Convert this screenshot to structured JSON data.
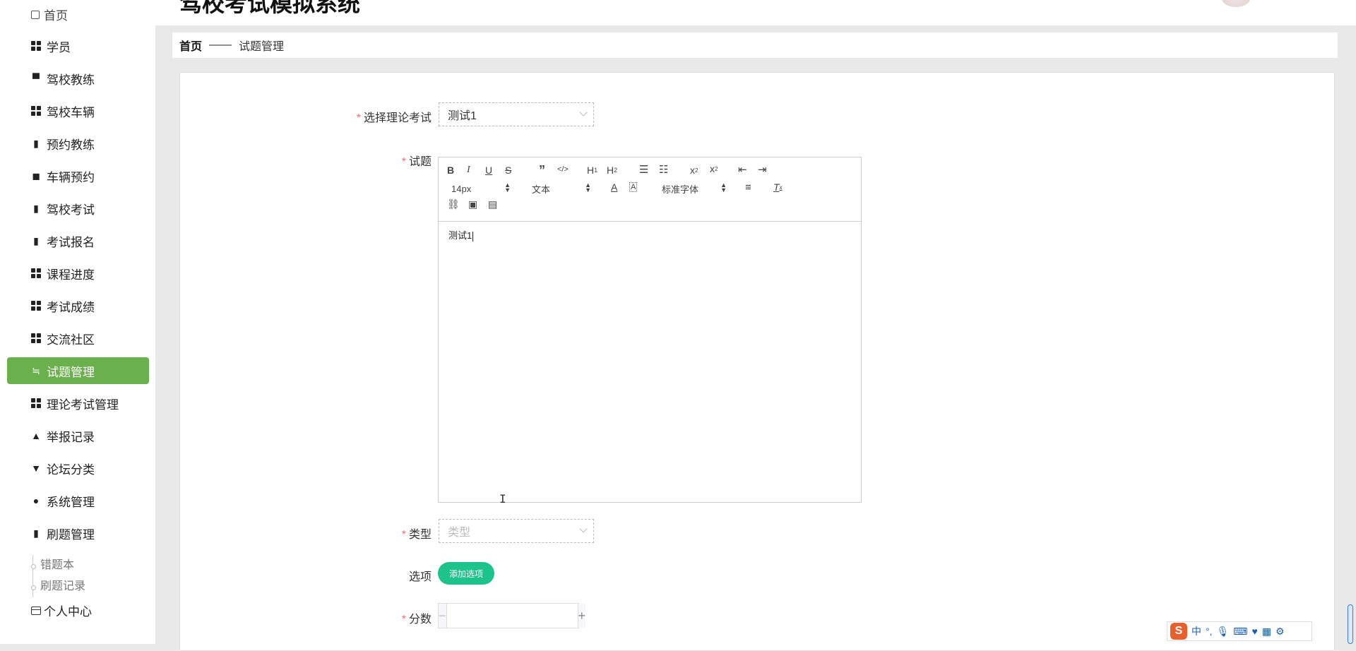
{
  "app": {
    "title": "驾校考试模拟系统"
  },
  "sidebar": {
    "top_item": "首页",
    "items": [
      {
        "label": "学员",
        "icon": "grid-icon"
      },
      {
        "label": "驾校教练",
        "icon": "monitor-icon"
      },
      {
        "label": "驾校车辆",
        "icon": "grid-icon"
      },
      {
        "label": "预约教练",
        "icon": "clipboard-icon"
      },
      {
        "label": "车辆预约",
        "icon": "wallet-icon"
      },
      {
        "label": "驾校考试",
        "icon": "clipboard-x-icon"
      },
      {
        "label": "考试报名",
        "icon": "books-icon"
      },
      {
        "label": "课程进度",
        "icon": "grid-icon"
      },
      {
        "label": "考试成绩",
        "icon": "grid-icon"
      },
      {
        "label": "交流社区",
        "icon": "grid-icon"
      },
      {
        "label": "试题管理",
        "icon": "sliders-icon",
        "active": true
      },
      {
        "label": "理论考试管理",
        "icon": "grid-icon"
      },
      {
        "label": "举报记录",
        "icon": "stamp-icon"
      },
      {
        "label": "论坛分类",
        "icon": "pin-icon"
      },
      {
        "label": "系统管理",
        "icon": "user-icon"
      },
      {
        "label": "刷题管理",
        "icon": "clipboard-check-icon"
      }
    ],
    "sub_items": [
      "错题本",
      "刷题记录"
    ],
    "personal_center": "个人中心"
  },
  "breadcrumb": {
    "home": "首页",
    "separator": "——",
    "current": "试题管理"
  },
  "form": {
    "exam_label": "选择理论考试",
    "exam_value": "测试1",
    "question_label": "试题",
    "editor": {
      "font_size": "14px",
      "text_type": "文本",
      "font_family": "标准字体",
      "content": "测试1"
    },
    "type_label": "类型",
    "type_placeholder": "类型",
    "options_label": "选项",
    "add_option_button": "添加选项",
    "score_label": "分数",
    "required_mark": "*"
  },
  "ime": {
    "logo": "S",
    "mode": "中"
  },
  "colors": {
    "active_menu": "#6ab04c",
    "add_button": "#1ec38b",
    "required": "#f56c6c"
  }
}
